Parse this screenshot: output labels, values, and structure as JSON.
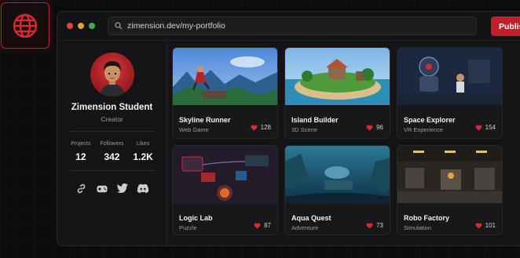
{
  "browser": {
    "url": "zimension.dev/my-portfolio",
    "publish_label": "Publis"
  },
  "colors": {
    "accent": "#c21d2a",
    "traffic_red": "#e0443e",
    "traffic_yellow": "#d9a53a",
    "traffic_green": "#3fae4a"
  },
  "profile": {
    "name": "Zimension Student",
    "role": "Creator",
    "stats": [
      {
        "label": "Projects",
        "value": "12"
      },
      {
        "label": "Followers",
        "value": "342"
      },
      {
        "label": "Likes",
        "value": "1.2K"
      }
    ],
    "socials": [
      "link-icon",
      "gamepad-icon",
      "twitter-icon",
      "discord-icon"
    ]
  },
  "projects": [
    {
      "title": "Skyline Runner",
      "type": "Web Game",
      "likes": "128"
    },
    {
      "title": "Island Builder",
      "type": "3D Scene",
      "likes": "96"
    },
    {
      "title": "Space Explorer",
      "type": "VR Experience",
      "likes": "154"
    },
    {
      "title": "Logic Lab",
      "type": "Puzzle",
      "likes": "87"
    },
    {
      "title": "Aqua Quest",
      "type": "Adventure",
      "likes": "73"
    },
    {
      "title": "Robo Factory",
      "type": "Simulation",
      "likes": "101"
    }
  ]
}
